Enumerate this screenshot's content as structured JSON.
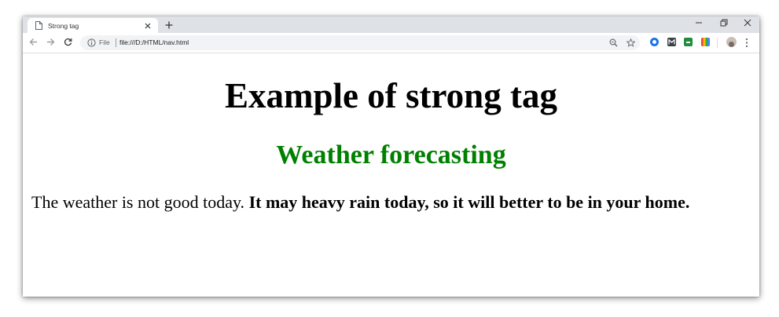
{
  "tab": {
    "title": "Strong tag",
    "favicon": "document-icon"
  },
  "window_controls": [
    "minimize-icon",
    "restore-icon",
    "close-icon"
  ],
  "address_bar": {
    "scheme_label": "File",
    "url": "file:///D:/HTML/nav.html"
  },
  "extensions": [
    "blue-circle-extension",
    "m-extension",
    "green-extension",
    "color-bars-extension"
  ],
  "page": {
    "heading": "Example of strong tag",
    "subheading": "Weather forecasting",
    "paragraph_normal": "The weather is not good today. ",
    "paragraph_strong": "It may heavy rain today, so it will better to be in your home."
  },
  "colors": {
    "subheading": "#008000",
    "tabstrip": "#dee1e6",
    "omnibox": "#f1f3f4"
  }
}
